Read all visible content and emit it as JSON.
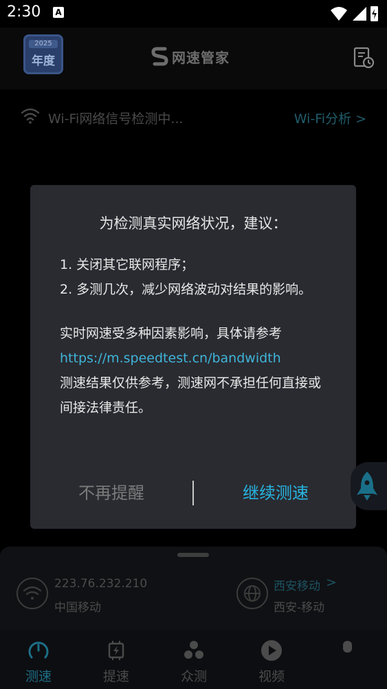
{
  "status_bar": {
    "time": "2:30",
    "notification_letter": "A"
  },
  "app_bar": {
    "badge_year": "2025",
    "badge_text": "年度",
    "brand_name": "网速管家"
  },
  "wifi": {
    "status_text": "Wi-Fi网络信号检测中...",
    "analysis_link": "Wi-Fi分析 >"
  },
  "dialog": {
    "title": "为检测真实网络状况，建议：",
    "item1": "1. 关闭其它联网程序；",
    "item2": "2. 多测几次，减少网络波动对结果的影响。",
    "note_prefix": "实时网速受多种因素影响，具体请参考",
    "note_link": "https://m.speedtest.cn/bandwidth",
    "disclaimer": "测速结果仅供参考，测速网不承担任何直接或间接法律责任。",
    "dismiss_label": "不再提醒",
    "continue_label": "继续测速"
  },
  "panel": {
    "ip": "223.76.232.210",
    "isp": "中国移动",
    "node_name": "西安移动",
    "node_chevron": ">",
    "node_location": "西安-移动"
  },
  "tabs": [
    {
      "label": "测速",
      "icon": "speedometer-icon",
      "active": true
    },
    {
      "label": "提速",
      "icon": "chip-boost-icon",
      "active": false
    },
    {
      "label": "众测",
      "icon": "crowd-test-icon",
      "active": false
    },
    {
      "label": "视频",
      "icon": "play-icon",
      "active": false
    }
  ],
  "colors": {
    "accent": "#27b4e0",
    "link": "#3fb4d8",
    "dialog_bg": "#2a2b31"
  }
}
